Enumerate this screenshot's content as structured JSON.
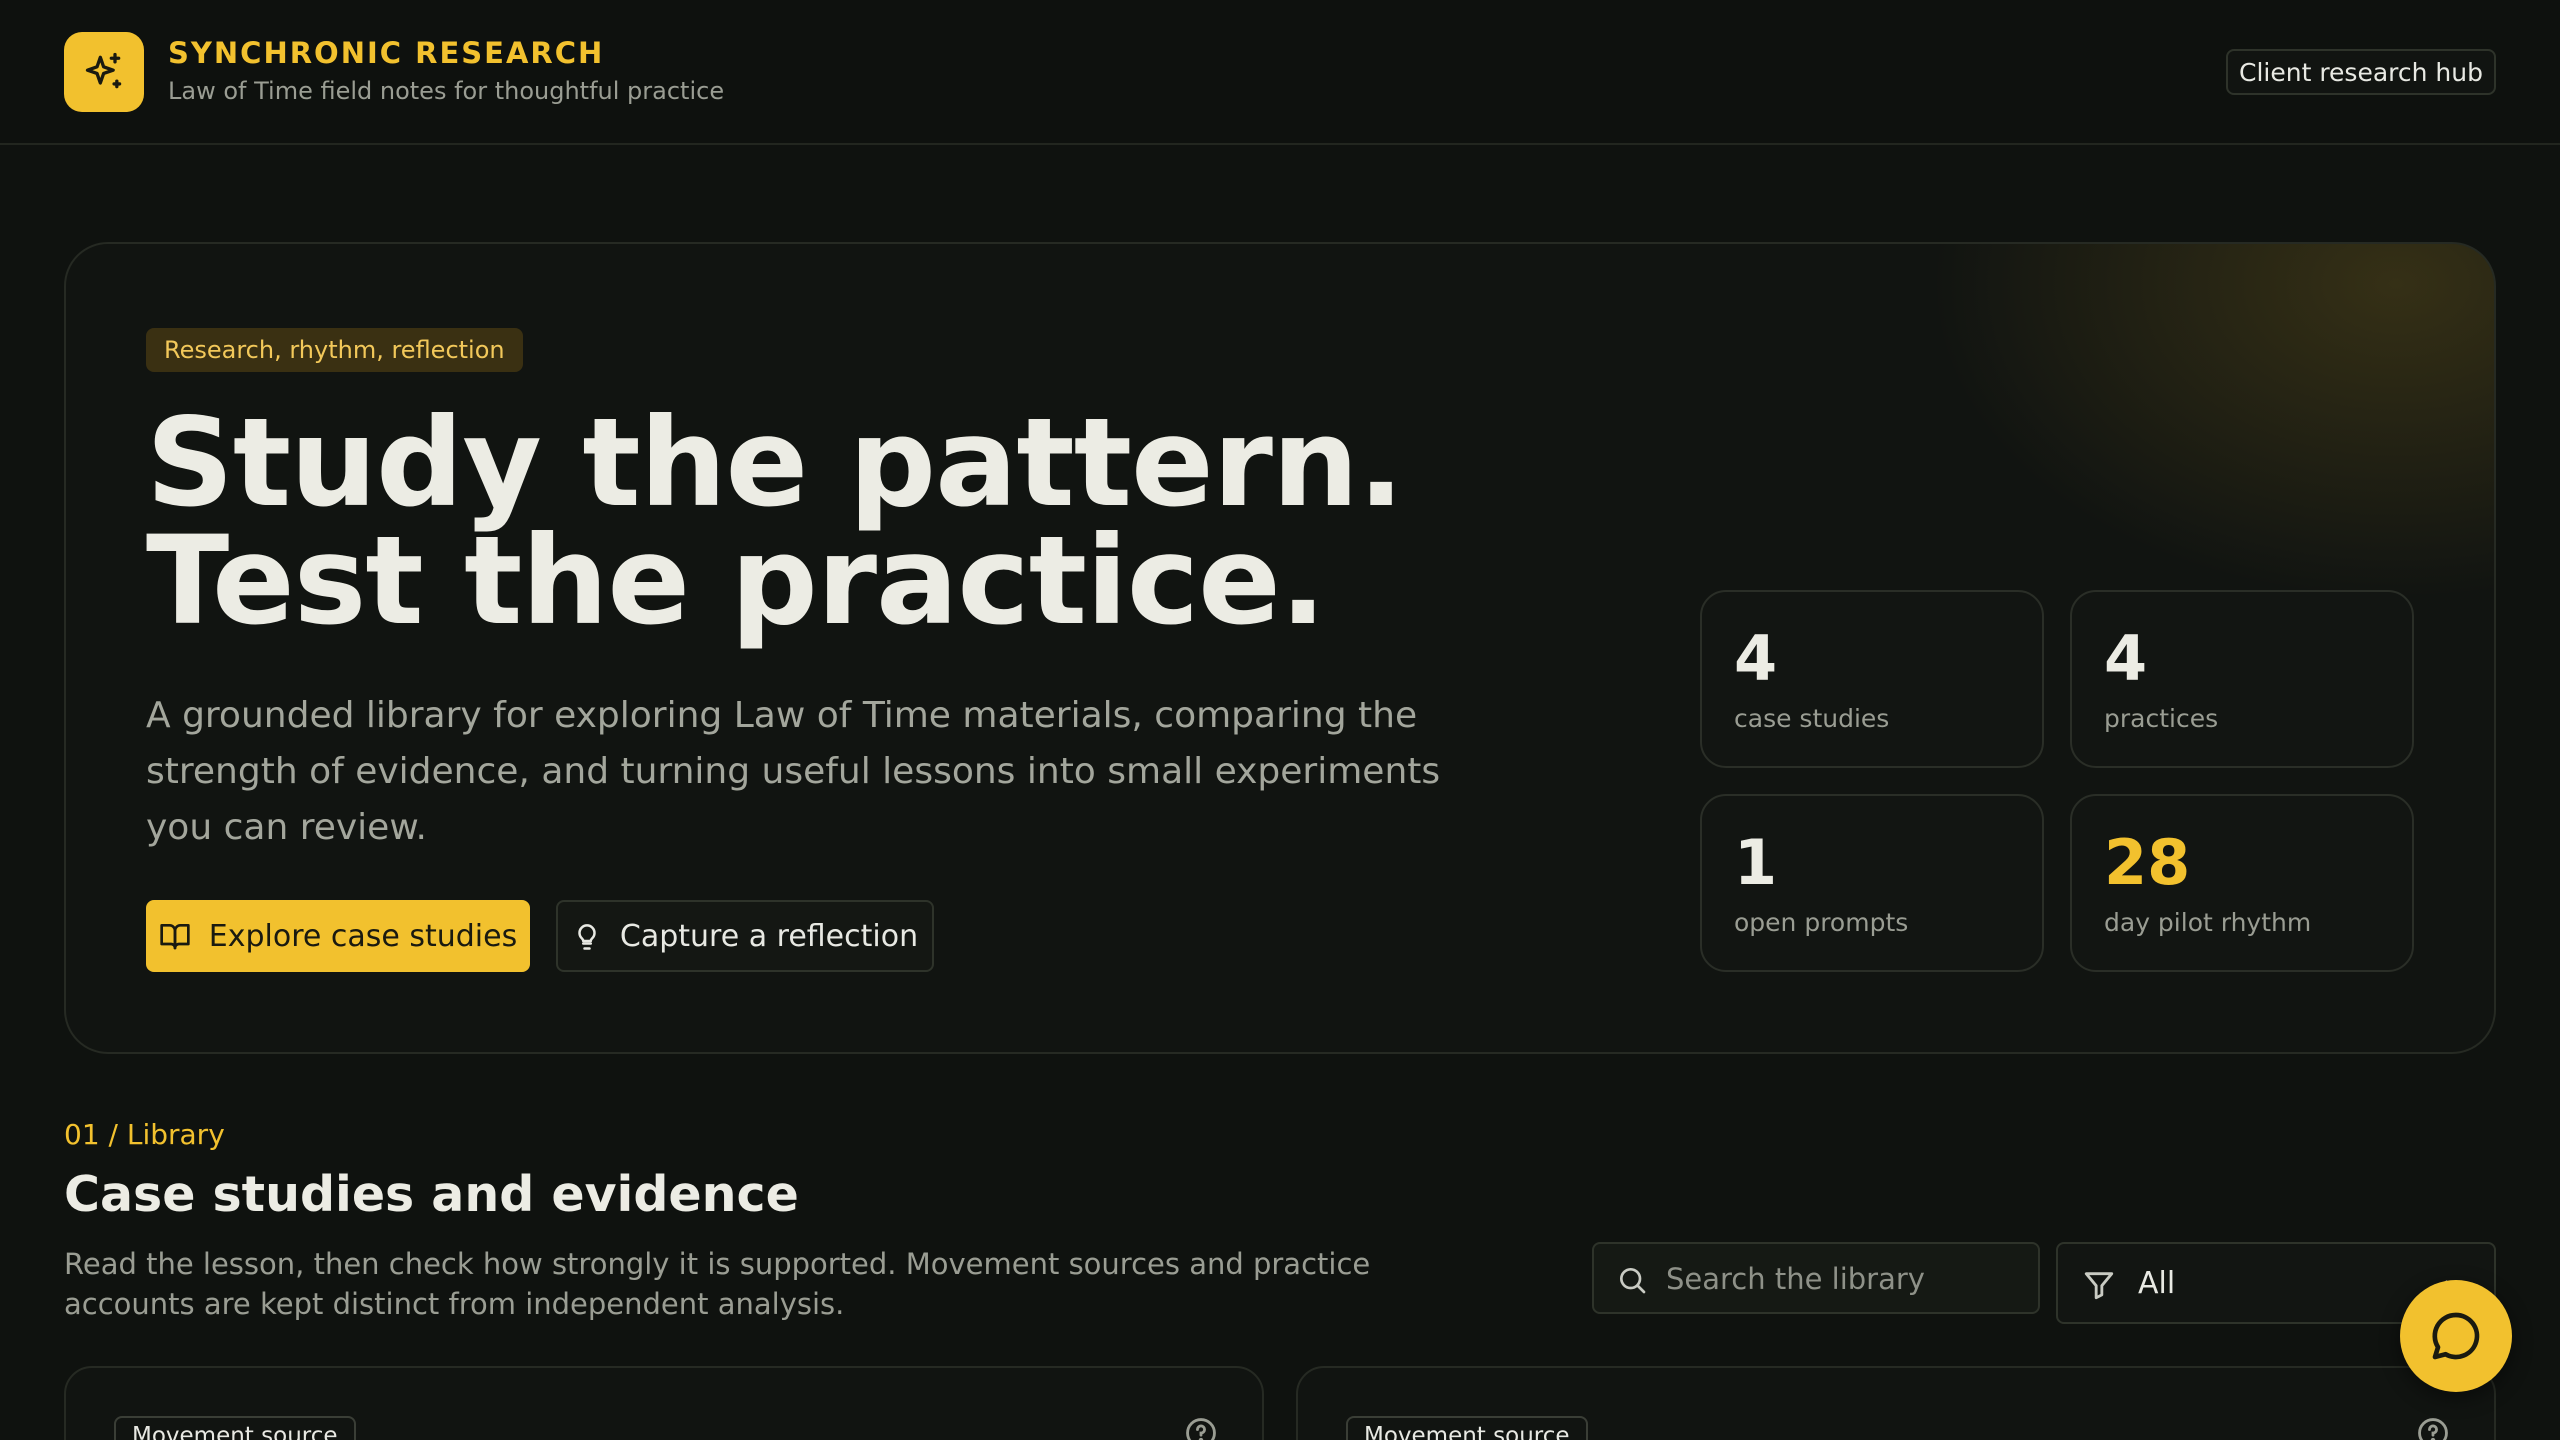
{
  "header": {
    "brand_title": "SYNCHRONIC RESEARCH",
    "brand_subtitle": "Law of Time field notes for thoughtful practice",
    "hub_button": "Client research hub"
  },
  "hero": {
    "pill": "Research, rhythm, reflection",
    "title_line1": "Study the pattern.",
    "title_line2": "Test the practice.",
    "description": "A grounded library for exploring Law of Time materials, comparing the strength of evidence, and turning useful lessons into small experiments you can review.",
    "primary_button": "Explore case studies",
    "secondary_button": "Capture a reflection",
    "stats": [
      {
        "value": "4",
        "label": "case studies"
      },
      {
        "value": "4",
        "label": "practices"
      },
      {
        "value": "1",
        "label": "open prompts"
      },
      {
        "value": "28",
        "label": "day pilot rhythm"
      }
    ]
  },
  "library": {
    "kicker": "01 / Library",
    "title": "Case studies and evidence",
    "description": "Read the lesson, then check how strongly it is supported. Movement sources and practice accounts are kept distinct from independent analysis.",
    "search_placeholder": "Search the library",
    "filter_value": "All",
    "cards": [
      {
        "tag": "Movement source"
      },
      {
        "tag": "Movement source"
      }
    ]
  },
  "colors": {
    "accent": "#f2c12e",
    "background": "#0f120f"
  }
}
